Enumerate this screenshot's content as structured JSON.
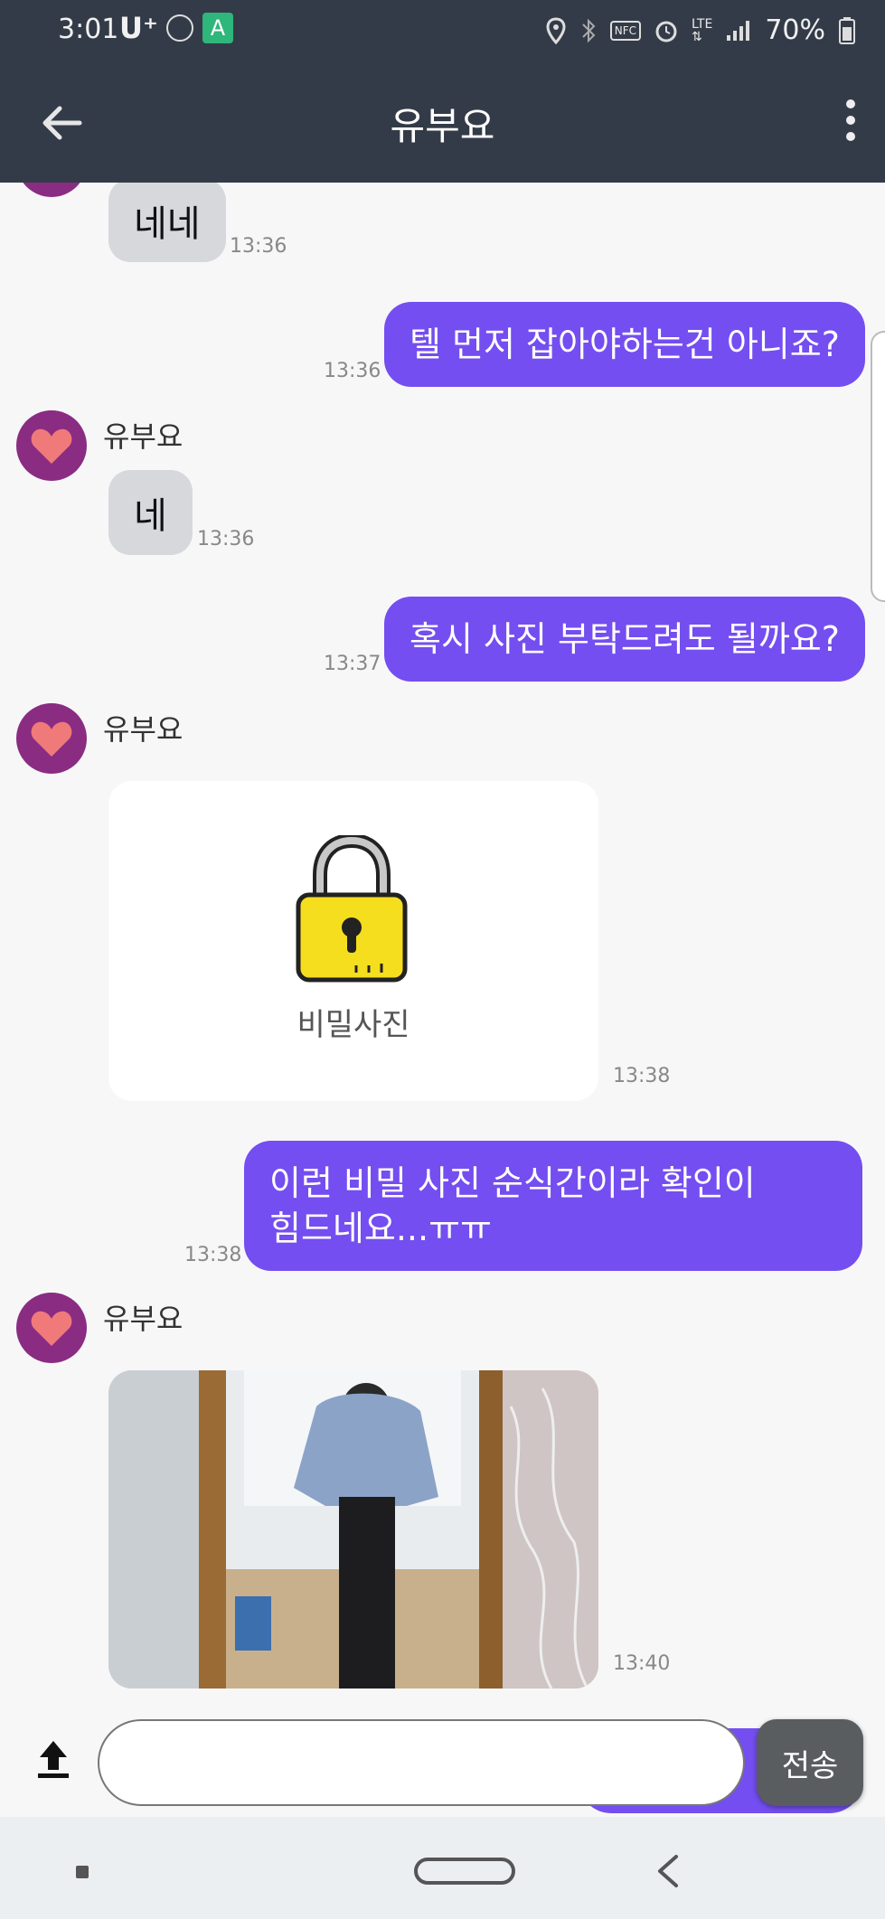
{
  "status_bar": {
    "time": "3:01",
    "carrier": "U⁺",
    "battery": "70%"
  },
  "header": {
    "title": "유부요"
  },
  "messages": [
    {
      "text": "네네",
      "time": "13:36"
    },
    {
      "text": "텔 먼저 잡아야하는건 아니죠?",
      "time": "13:36"
    },
    {
      "sender": "유부요",
      "text": "네",
      "time": "13:36"
    },
    {
      "text": "혹시 사진 부탁드려도 될까요?",
      "time": "13:37"
    },
    {
      "sender": "유부요",
      "card_label": "비밀사진",
      "time": "13:38"
    },
    {
      "text_line1": "이런 비밀 사진 순식간이라 확인이",
      "text_line2": "힘드네요...ㅠㅠ",
      "time": "13:38"
    },
    {
      "sender": "유부요",
      "time": "13:40"
    }
  ],
  "input": {
    "placeholder": "",
    "send_label": "전송"
  },
  "colors": {
    "header_bg": "#343b48",
    "outgoing_bubble": "#744ef0",
    "incoming_bubble": "#d6d8dc",
    "avatar_bg": "#8a2c82",
    "heart": "#f07a7a",
    "lock_yellow": "#f5de1e"
  },
  "icons": {
    "back": "arrow-left-icon",
    "more": "more-vertical-icon",
    "avatar": "heart-icon",
    "lock": "lock-icon",
    "upload": "upload-icon"
  }
}
